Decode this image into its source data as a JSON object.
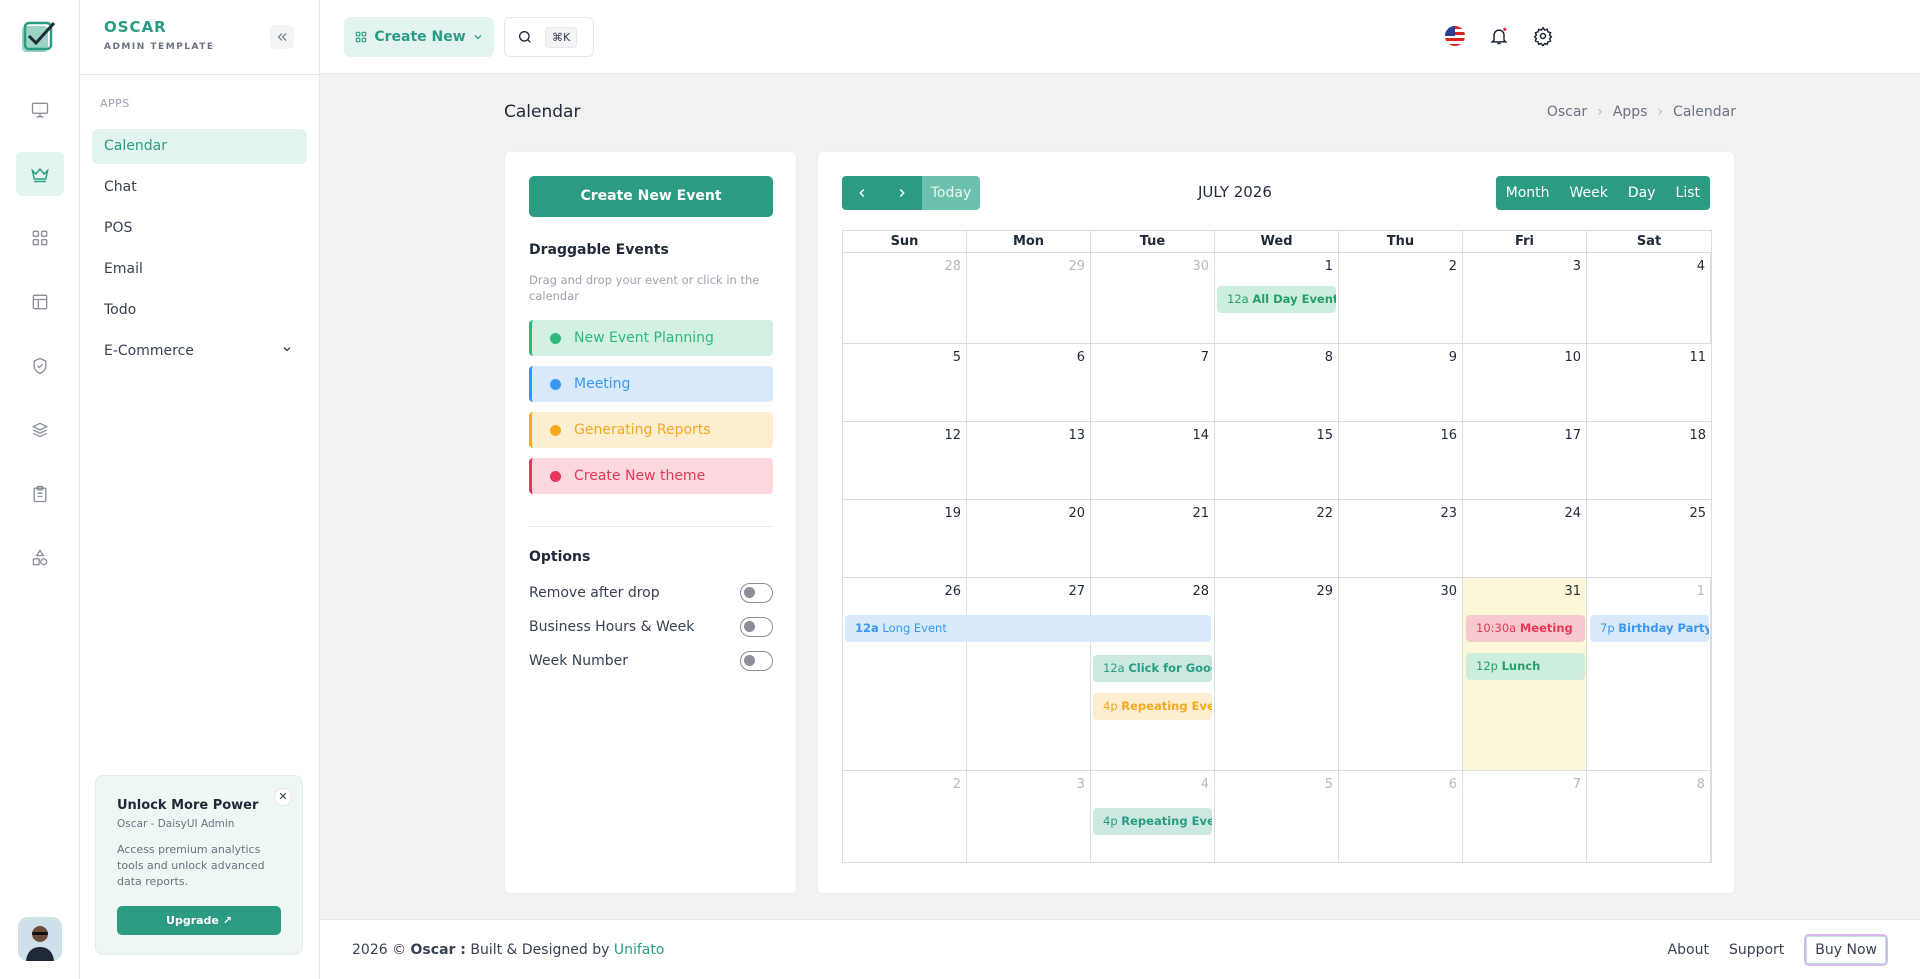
{
  "app": {
    "name": "OSCAR",
    "tagline": "ADMIN TEMPLATE"
  },
  "sidebar": {
    "section": "APPS",
    "items": [
      {
        "label": "Calendar",
        "active": true
      },
      {
        "label": "Chat"
      },
      {
        "label": "POS"
      },
      {
        "label": "Email"
      },
      {
        "label": "Todo"
      },
      {
        "label": "E-Commerce",
        "has_children": true
      }
    ]
  },
  "rail_icons": [
    "monitor-icon",
    "crown-icon",
    "grid-icon",
    "layout-icon",
    "shield-check-icon",
    "layers-icon",
    "clipboard-icon",
    "shapes-icon"
  ],
  "promo": {
    "title": "Unlock More Power",
    "subtitle": "Oscar - DaisyUI Admin",
    "description": "Access premium analytics tools and unlock advanced data reports.",
    "button": "Upgrade ↗",
    "close": "✕"
  },
  "topbar": {
    "create_label": "Create New",
    "shortcut": "⌘K"
  },
  "page": {
    "title": "Calendar",
    "breadcrumb": [
      "Oscar",
      "Apps",
      "Calendar"
    ]
  },
  "events_panel": {
    "create_button": "Create New Event",
    "draggable_title": "Draggable Events",
    "draggable_help": "Drag and drop your event or click in the calendar",
    "events": [
      {
        "label": "New Event Planning",
        "color": "#2fb87a",
        "bg": "#d3f1e2"
      },
      {
        "label": "Meeting",
        "color": "#3a97f0",
        "bg": "#d7e9fb"
      },
      {
        "label": "Generating Reports",
        "color": "#f4aa1c",
        "bg": "#fdeed2"
      },
      {
        "label": "Create New theme",
        "color": "#e8375a",
        "bg": "#fbd8de"
      }
    ],
    "options_title": "Options",
    "options": [
      {
        "label": "Remove after drop",
        "on": false
      },
      {
        "label": "Business Hours & Week",
        "on": false
      },
      {
        "label": "Week Number",
        "on": false
      }
    ]
  },
  "calendar": {
    "title": "JULY 2026",
    "today_label": "Today",
    "views": [
      "Month",
      "Week",
      "Day",
      "List"
    ],
    "weekdays": [
      "Sun",
      "Mon",
      "Tue",
      "Wed",
      "Thu",
      "Fri",
      "Sat"
    ],
    "weeks": [
      [
        "28",
        "29",
        "30",
        "1",
        "2",
        "3",
        "4"
      ],
      [
        "5",
        "6",
        "7",
        "8",
        "9",
        "10",
        "11"
      ],
      [
        "12",
        "13",
        "14",
        "15",
        "16",
        "17",
        "18"
      ],
      [
        "19",
        "20",
        "21",
        "22",
        "23",
        "24",
        "25"
      ],
      [
        "26",
        "27",
        "28",
        "29",
        "30",
        "31",
        "1"
      ],
      [
        "2",
        "3",
        "4",
        "5",
        "6",
        "7",
        "8"
      ]
    ],
    "events": [
      {
        "time": "12a",
        "title": "All Day Event"
      },
      {
        "time": "12a",
        "title": "Long Event"
      },
      {
        "time": "10:30a",
        "title": "Meeting"
      },
      {
        "time": "7p",
        "title": "Birthday Party"
      },
      {
        "time": "12p",
        "title": "Lunch"
      },
      {
        "time": "12a",
        "title": "Click for Google"
      },
      {
        "time": "4p",
        "title": "Repeating Event"
      },
      {
        "time": "4p",
        "title": "Repeating Event"
      }
    ]
  },
  "footer": {
    "year_prefix": "2026 © ",
    "brand": "Oscar :",
    "built": " Built & Designed by ",
    "author": "Unifato",
    "links": [
      "About",
      "Support"
    ],
    "buy": "Buy Now"
  }
}
